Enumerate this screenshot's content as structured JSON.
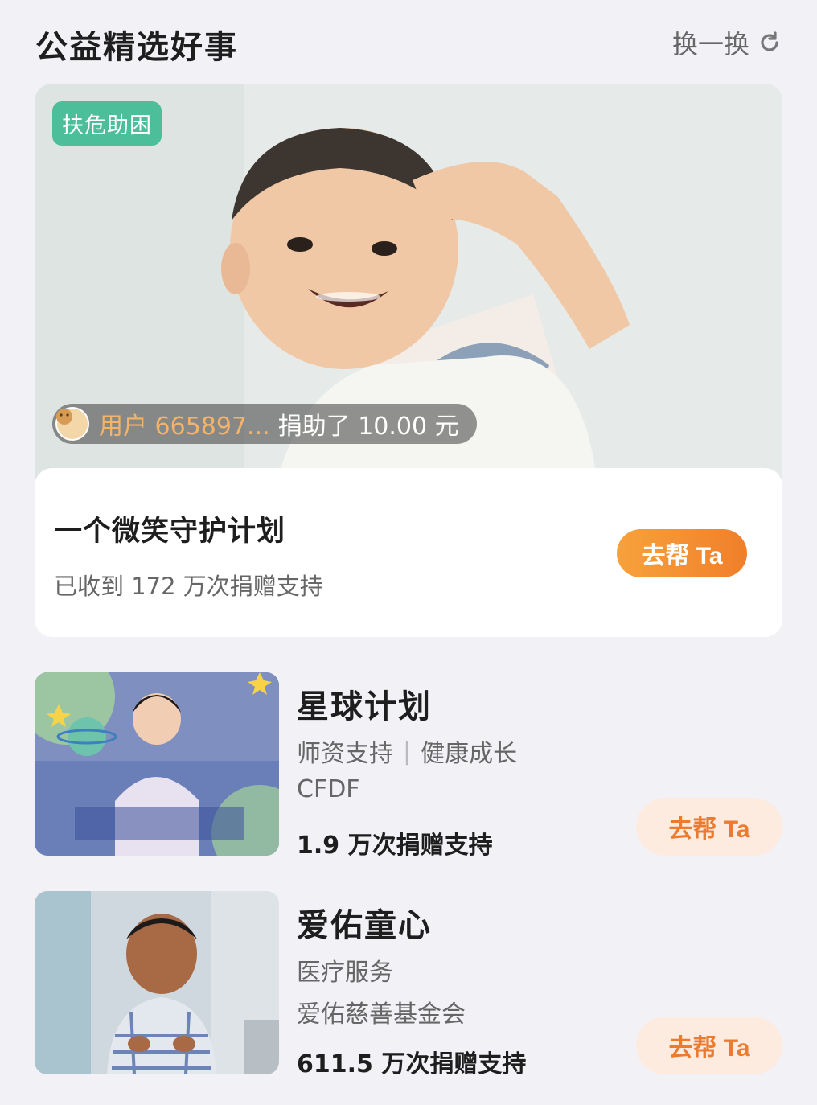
{
  "header": {
    "title": "公益精选好事",
    "refresh_label": "换一换"
  },
  "hero": {
    "badge": "扶危助困",
    "donation_user": "用户 665897...",
    "donation_text": "捐助了 10.00 元",
    "name": "一个微笑守护计划",
    "count": "已收到 172 万次捐赠支持",
    "button_label": "去帮 Ta"
  },
  "items": [
    {
      "title": "星球计划",
      "tag1": "师资支持",
      "tag2": "健康成长",
      "org": "CFDF",
      "count": "1.9 万次捐赠支持",
      "button_label": "去帮 Ta"
    },
    {
      "title": "爱佑童心",
      "tag1": "医疗服务",
      "tag2": "",
      "org": "爱佑慈善基金会",
      "count": "611.5 万次捐赠支持",
      "button_label": "去帮 Ta"
    }
  ],
  "colors": {
    "accent": "#f07f2a",
    "badge_green": "#4cbf9a",
    "soft_button_bg": "#fdebe0"
  }
}
